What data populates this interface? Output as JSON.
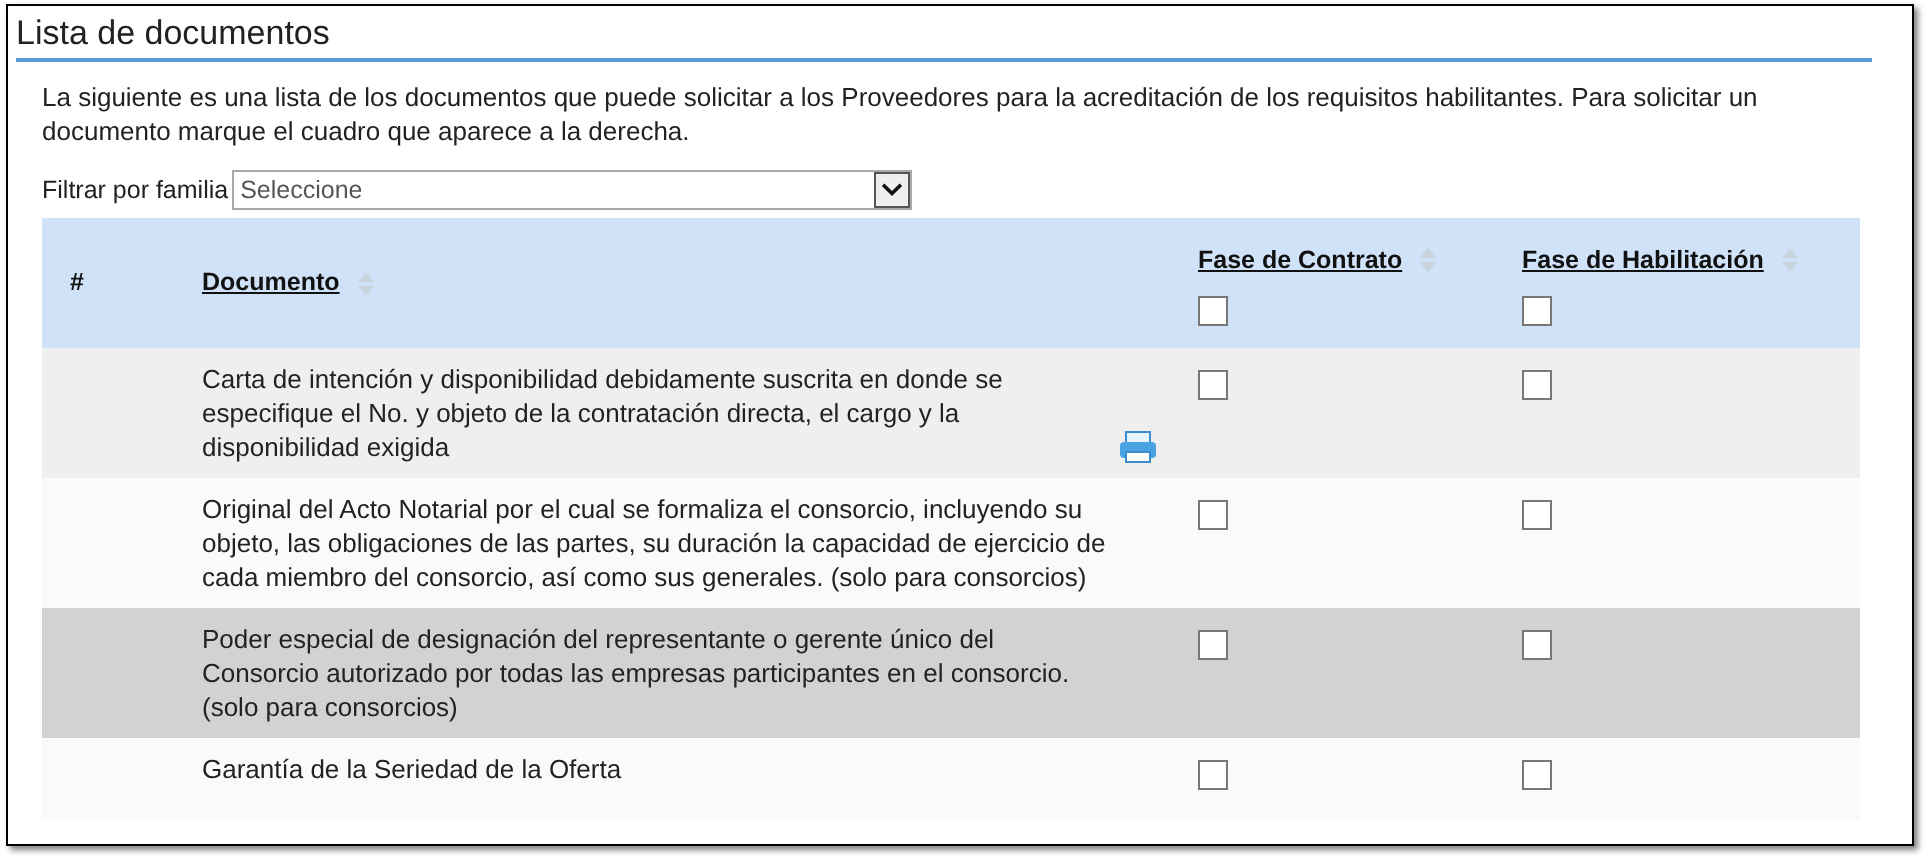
{
  "section_title": "Lista de documentos",
  "intro": "La siguiente es una lista de los documentos que puede solicitar a los Proveedores para la acreditación de los requisitos habilitantes. Para solicitar un documento marque el cuadro que aparece a la derecha.",
  "filter": {
    "label": "Filtrar por familia",
    "value": "Seleccione"
  },
  "table": {
    "number_header": "#",
    "document_header": "Documento",
    "phase_columns": [
      {
        "label": "Fase de Contrato",
        "checked": false
      },
      {
        "label": "Fase de Habilitación",
        "checked": false
      }
    ],
    "rows": [
      {
        "document": "Carta de intención y disponibilidad debidamente suscrita en donde se especifique el No. y objeto de la contratación directa, el cargo y la disponibilidad exigida",
        "attachment": true,
        "highlighted": false,
        "contrato": false,
        "habilitacion": false
      },
      {
        "document": "Original del Acto Notarial por el cual se formaliza el consorcio, incluyendo su objeto, las obligaciones de las partes, su duración la capacidad de ejercicio de cada miembro del consorcio, así como sus generales. (solo para consorcios)",
        "attachment": false,
        "highlighted": false,
        "contrato": false,
        "habilitacion": false
      },
      {
        "document": "Poder especial de designación del representante o gerente único del Consorcio autorizado por todas las empresas participantes en el consorcio. (solo para consorcios)",
        "attachment": false,
        "highlighted": true,
        "contrato": false,
        "habilitacion": false
      },
      {
        "document": "Garantía de la Seriedad de la Oferta",
        "attachment": false,
        "highlighted": false,
        "contrato": false,
        "habilitacion": false
      }
    ]
  }
}
